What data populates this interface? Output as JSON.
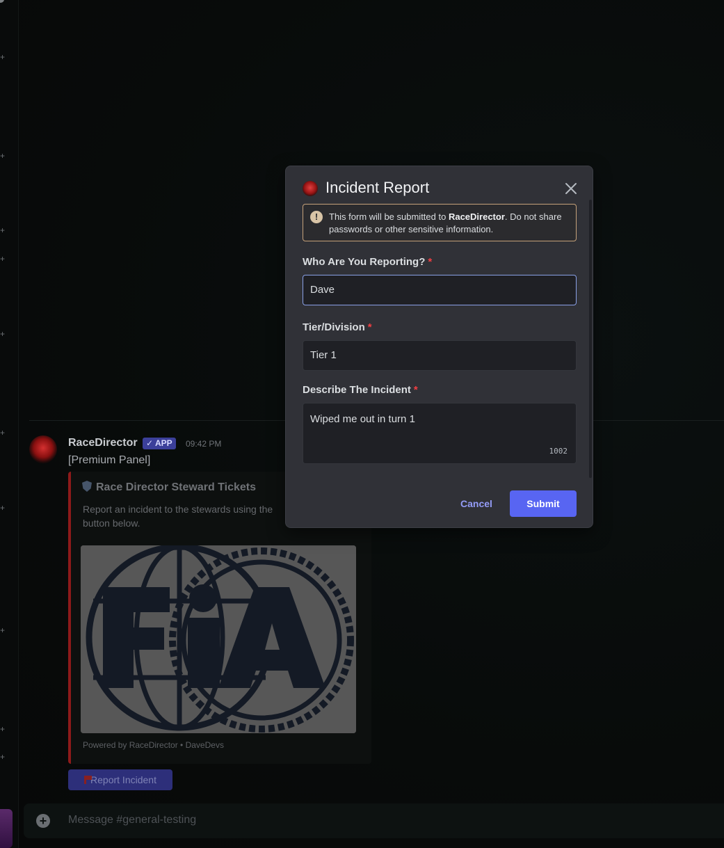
{
  "modal": {
    "title": "Incident Report",
    "close_icon": "close-icon",
    "warning": {
      "icon": "exclamation-icon",
      "text_before": "This form will be submitted to ",
      "app_name": "RaceDirector",
      "text_after": ". Do not share passwords or other sensitive information."
    },
    "fields": [
      {
        "label": "Who Are You Reporting?",
        "required_mark": "*",
        "value": "Dave"
      },
      {
        "label": "Tier/Division",
        "required_mark": "*",
        "value": "Tier 1"
      },
      {
        "label": "Describe The Incident",
        "required_mark": "*",
        "value": "Wiped me out in turn 1",
        "char_counter": "1002"
      }
    ],
    "cancel_label": "Cancel",
    "submit_label": "Submit"
  },
  "message": {
    "author": "RaceDirector",
    "badge": "✓ APP",
    "time": "09:42 PM",
    "text": "[Premium Panel]",
    "embed": {
      "title": "Race Director Steward Tickets",
      "description": "Report an incident to the stewards using the button below.",
      "image_text": "FiA",
      "footer": "Powered by RaceDirector • DaveDevs"
    },
    "button_label": "Report Incident"
  },
  "composer": {
    "placeholder": "Message #general-testing"
  },
  "colors": {
    "accent": "#5865f2",
    "warning_border": "#c6a27a",
    "required": "#f23f43",
    "embed_bar": "#8d1a1a"
  }
}
